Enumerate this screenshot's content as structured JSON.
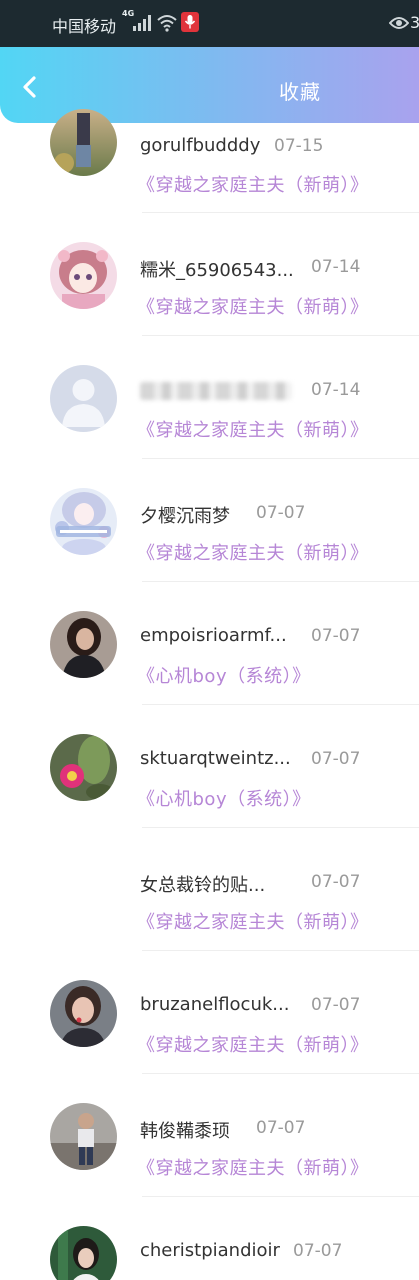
{
  "status_bar": {
    "carrier": "中国移动",
    "network": "4G",
    "battery_partial": "3"
  },
  "header": {
    "title": "收藏"
  },
  "colors": {
    "header_gradient": [
      "#52d6f4",
      "#a9a2ee"
    ],
    "book_title": "#b686d6",
    "username": "#333333",
    "date": "#9a9a9a"
  },
  "favorites": [
    {
      "username": "gorulfbudddy",
      "date": "07-15",
      "book": "《穿越之家庭主夫（新萌）》",
      "avatar": "photo-field"
    },
    {
      "username": "糯米_65906543...",
      "date": "07-14",
      "book": "《穿越之家庭主夫（新萌）》",
      "avatar": "anime-girl"
    },
    {
      "username": "",
      "date": "07-14",
      "book": "《穿越之家庭主夫（新萌）》",
      "avatar": "default-person"
    },
    {
      "username": "夕樱沉雨梦",
      "date": "07-07",
      "book": "《穿越之家庭主夫（新萌）》",
      "avatar": "anime-title"
    },
    {
      "username": "empoisrioarmf...",
      "date": "07-07",
      "book": "《心机boy（系统）》",
      "avatar": "photo-woman-dark"
    },
    {
      "username": "sktuarqtweintz...",
      "date": "07-07",
      "book": "《心机boy（系统）》",
      "avatar": "photo-cactus"
    },
    {
      "username": "女总裁铃的贴...",
      "date": "07-07",
      "book": "《穿越之家庭主夫（新萌）》",
      "avatar": "none"
    },
    {
      "username": "bruzanelflocuk...",
      "date": "07-07",
      "book": "《穿越之家庭主夫（新萌）》",
      "avatar": "photo-woman-light"
    },
    {
      "username": "韩俊鞴黍顼",
      "date": "07-07",
      "book": "《穿越之家庭主夫（新萌）》",
      "avatar": "photo-man-street"
    },
    {
      "username": "cheristpiandioir",
      "date": "07-07",
      "book": "",
      "avatar": "photo-woman-green"
    }
  ]
}
